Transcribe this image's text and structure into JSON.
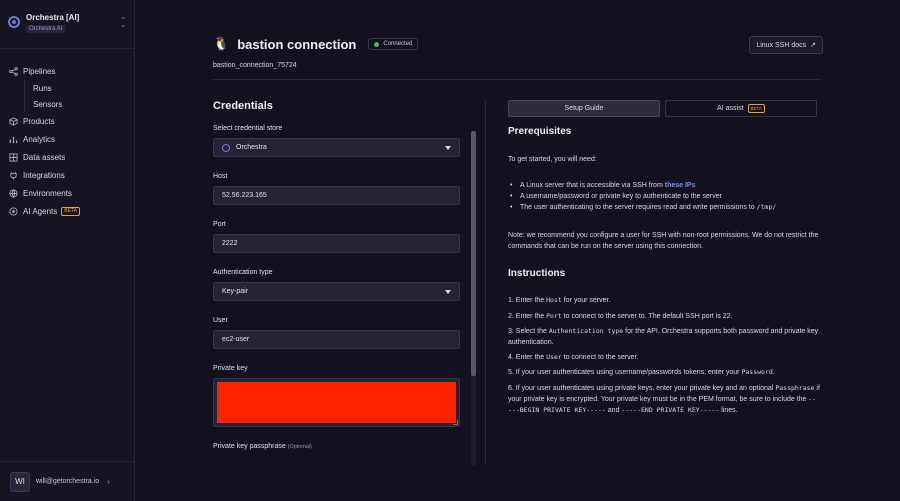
{
  "org": {
    "name": "Orchestra [AI]",
    "sub": "Orchestra AI"
  },
  "nav": {
    "pipelines": "Pipelines",
    "runs": "Runs",
    "sensors": "Sensors",
    "products": "Products",
    "analytics": "Analytics",
    "data_assets": "Data assets",
    "integrations": "Integrations",
    "environments": "Environments",
    "ai_agents": "AI Agents",
    "beta": "BETA"
  },
  "user": {
    "initials": "WI",
    "email": "will@getorchestra.io"
  },
  "header": {
    "title": "bastion connection",
    "status": "Connected",
    "subtitle": "bastion_connection_75724",
    "docs_button": "Linux SSH docs"
  },
  "credentials": {
    "title": "Credentials",
    "store_label": "Select credential store",
    "store_value": "Orchestra",
    "host_label": "Host",
    "host_value": "52.56.223.165",
    "port_label": "Port",
    "port_value": "2222",
    "auth_label": "Authentication type",
    "auth_value": "Key-pair",
    "user_label": "User",
    "user_value": "ec2-user",
    "key_label": "Private key",
    "passphrase_label": "Private key passphrase",
    "optional": "(Optional)"
  },
  "guide": {
    "tab_setup": "Setup Guide",
    "tab_ai": "AI assist",
    "tab_ai_badge": "BETA",
    "prereq_title": "Prerequisites",
    "intro": "To get started, you will need:",
    "b1_text": "A Linux server that is accessible via SSH from ",
    "b1_link": "these IPs",
    "b2": "A username/password or private key to authenticate to the server",
    "b3_text": "The user authenticating to the server requires read and write permissions to ",
    "b3_code": "/tmp/",
    "note": "Note: we recommend you configure a user for SSH with non-root permissions. We do not restrict the commands that can be run on the server using this connection.",
    "instr_title": "Instructions",
    "s1_a": "1. Enter the ",
    "s1_code": "Host",
    "s1_b": " for your server.",
    "s2_a": "2. Enter the ",
    "s2_code": "Port",
    "s2_b": " to connect to the server to. The default SSH port is 22.",
    "s3_a": "3. Select the ",
    "s3_code": "Authentication type",
    "s3_b": " for the API. Orchestra supports both password and private key authentication.",
    "s4_a": "4. Enter the ",
    "s4_code": "User",
    "s4_b": " to connect to the server.",
    "s5_a": "5. If your user authenticates using username/passwords tokens, enter your ",
    "s5_code": "Password",
    "s5_b": ".",
    "s6_a": "6. If your user authenticates using private keys, enter your private key and an optional ",
    "s6_code1": "Passphrase",
    "s6_b": " if your private key is encrypted. Your private key must be in the PEM format, be sure to include the ",
    "s6_code2": "-----BEGIN PRIVATE KEY-----",
    "s6_c": " and ",
    "s6_code3": "-----END PRIVATE KEY-----",
    "s6_d": " lines."
  }
}
